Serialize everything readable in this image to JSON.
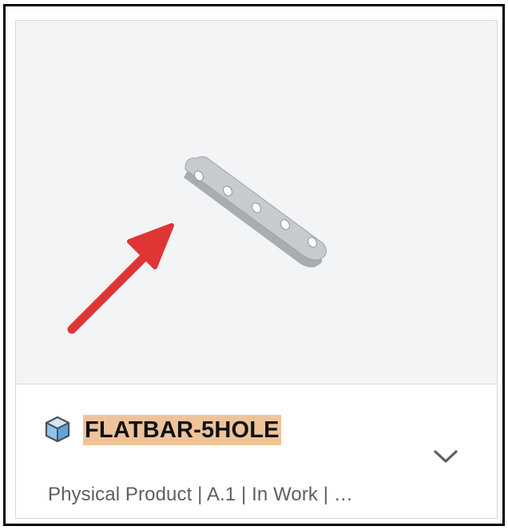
{
  "card": {
    "title": "FLATBAR-5HOLE",
    "subtitle": "Physical Product | A.1 | In Work | …",
    "highlight_color": "#efc39a",
    "icons": {
      "product": "3d-part-cube-icon",
      "expand": "chevron-down-icon",
      "pointer": "red-arrow-annotation"
    },
    "thumbnail": {
      "description_name": "flatbar-3d-preview",
      "hole_count": 5,
      "annotation_color": "#e53a3a"
    }
  }
}
